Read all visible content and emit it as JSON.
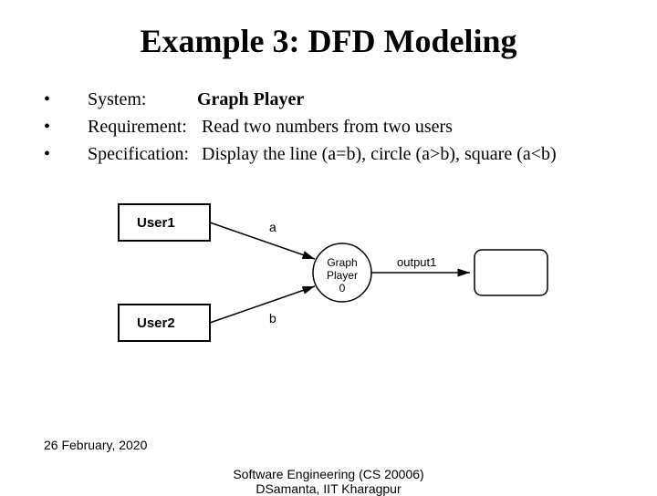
{
  "title": "Example 3: DFD Modeling",
  "bullets": [
    {
      "label": "System:",
      "value": "Graph Player",
      "value_bold": true
    },
    {
      "label": "Requirement:",
      "value": "Read two numbers from two users",
      "value_bold": false
    },
    {
      "label": "Specification:",
      "value": "Display the line (a=b), circle (a>b), square (a<b)",
      "value_bold": false
    }
  ],
  "diagram": {
    "entities": [
      "User1",
      "User2"
    ],
    "process": {
      "name": "Graph Player",
      "id": "0"
    },
    "flows": [
      {
        "label": "a",
        "from": "User1",
        "to": "Graph Player 0"
      },
      {
        "label": "b",
        "from": "User2",
        "to": "Graph Player 0"
      },
      {
        "label": "output1",
        "from": "Graph Player 0",
        "to": "sink"
      }
    ]
  },
  "footer": {
    "date": "26 February, 2020",
    "line1": "Software Engineering (CS 20006)",
    "line2": "DSamanta, IIT Kharagpur"
  }
}
